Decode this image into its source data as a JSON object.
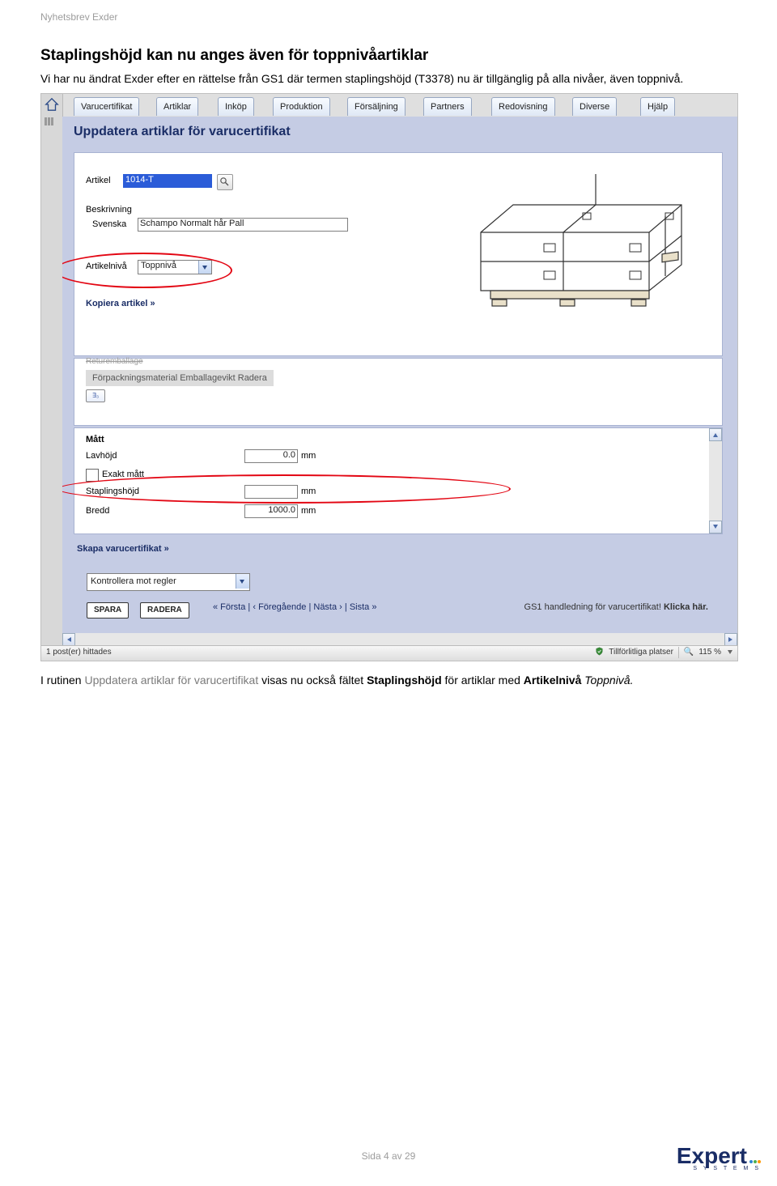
{
  "kicker": "Nyhetsbrev Exder",
  "heading": "Staplingshöjd kan nu anges även för toppnivåartiklar",
  "intro_parts": {
    "p1": "Vi har nu ändrat Exder efter en rättelse från GS1 där termen staplingshöjd (T3378) nu är tillgänglig på alla nivåer, även toppnivå."
  },
  "after_parts": {
    "t1": "I rutinen ",
    "routine": "Uppdatera artiklar för varucertifikat",
    "t2": " visas nu också fältet ",
    "bold1": "Staplingshöjd",
    "t3": " för artiklar med ",
    "bold2": "Artikelnivå",
    "italic": " Toppnivå."
  },
  "tabs": [
    "Varucertifikat",
    "Artiklar",
    "Inköp",
    "Produktion",
    "Försäljning",
    "Partners",
    "Redovisning",
    "Diverse",
    "Hjälp"
  ],
  "app": {
    "title": "Uppdatera artiklar för varucertifikat",
    "labels": {
      "artikel": "Artikel",
      "beskrivning": "Beskrivning",
      "svenska": "Svenska",
      "artikelniva": "Artikelnivå",
      "kopiera": "Kopiera artikel »",
      "retur": "Returemballage",
      "forpack": "Förpackningsmaterial Emballagevikt Radera",
      "badge": "∃₃",
      "matt": "Mått",
      "lavhojd": "Lavhöjd",
      "exakt": "Exakt mått",
      "staplingshojd": "Staplingshöjd",
      "bredd": "Bredd",
      "skapa": "Skapa varucertifikat »",
      "kontroll": "Kontrollera mot regler",
      "spara": "SPARA",
      "radera": "RADERA",
      "nav_first": "« Första",
      "nav_prev": "‹ Föregående",
      "nav_next": "Nästa ›",
      "nav_last": "Sista »",
      "gs1_text": "GS1 handledning för varucertifikat!",
      "gs1_click": "Klicka här.",
      "mm": "mm"
    },
    "values": {
      "artikel": "1014-T",
      "svenska": "Schampo Normalt hår Pall",
      "artikelniva": "Toppnivå",
      "lavhojd": "0.0",
      "staplingshojd": "",
      "bredd": "1000.0"
    },
    "status": {
      "left": "1 post(er) hittades",
      "trusted": "Tillförlitliga platser",
      "zoom": "115 %",
      "zoom_icon": "🔍"
    }
  },
  "footer": "Sida 4 av 29",
  "logo": {
    "brand": "Expert",
    "sub": "S Y S T E M S"
  }
}
